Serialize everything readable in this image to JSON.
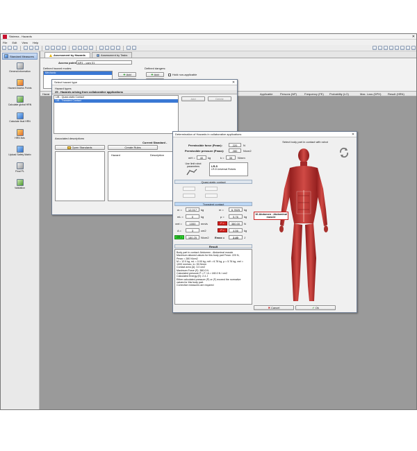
{
  "app": {
    "title": "Sistema - Hazards",
    "menu": [
      "File",
      "Edit",
      "View",
      "Help"
    ]
  },
  "sidebar": {
    "header": "Standard Measures",
    "items": [
      {
        "label": "General information",
        "icon": "info-document-icon"
      },
      {
        "label": "Hazard Assess Points",
        "icon": "hazard-points-icon"
      },
      {
        "label": "Calculate global HRN",
        "icon": "calculator-icon"
      },
      {
        "label": "Calculate final HRN",
        "icon": "calculator-final-icon"
      },
      {
        "label": "HRN lists",
        "icon": "list-icon"
      },
      {
        "label": "Upload Safety Matrix",
        "icon": "upload-matrix-icon"
      },
      {
        "label": "Final PL",
        "icon": "final-pl-icon"
      },
      {
        "label": "Validation",
        "icon": "validation-icon"
      }
    ]
  },
  "tabs": [
    {
      "label": "Assessment by Hazards",
      "active": true
    },
    {
      "label": "Assessment by Tasks",
      "active": false
    }
  ],
  "panel": {
    "access_point_label": "Access point:",
    "access_point_value": "AR1 - cam 01",
    "defined_hazards_label": "Defined hazard modes:",
    "defined_dangers_label": "Defined dangers:",
    "hazard_row": "Mechanic",
    "add_label": "Add",
    "delete_label": "Delete",
    "not_applicable_label": "Hold non-applicable"
  },
  "grid_header": {
    "hazard": "Hazar",
    "applicable": "Applicable",
    "persons": "Persons (NP)",
    "frequency": "Frequency (FE)",
    "probability": "Probability (LO)",
    "max_loss": "Max. Loss (DPH)",
    "result": "Result (HRN)"
  },
  "hazard_dialog": {
    "title": "Select hazard type",
    "hazard_types_label": "Hazard types",
    "group": "25 - Hazards arising from collaborative applications",
    "items": [
      "LIB - Quasi-static Contact",
      "LIB - Transient Contact"
    ],
    "selected_index": 1,
    "add_label": "Add",
    "delete_label": "Delete",
    "associated_label": "Associated descriptions",
    "current_standard_label": "Current Standard -",
    "open_standards": "Open Standards",
    "create_rules": "Create Rules",
    "col_hazard": "Hazard",
    "col_description": "Description"
  },
  "determination": {
    "title": "Determination of Hazards in collaborative applications",
    "perm_force_label": "Permissible force (Fmax):",
    "perm_force_value": "220",
    "perm_force_unit": "N",
    "perm_pressure_label": "Permissible pressure (Pmax):",
    "perm_pressure_value": "280",
    "perm_pressure_unit": "N/cm2",
    "mh_label": "mH =",
    "mh_value": "40",
    "mh_unit": "kg",
    "k_label": "k =",
    "k_value": "35",
    "k_unit": "N/mm",
    "limit_params_label": "Use limit robot parameters",
    "lr_code": "LR-5",
    "lr_desc": "LR-5 Universal Robots",
    "quasi_static_label": "Quasi-static contact",
    "transient_label": "Transient contact",
    "rows": [
      {
        "l1": "m =",
        "v1": "12.017",
        "u1": "kg",
        "l2": "m =",
        "v2": "6.7825",
        "u2": "kg"
      },
      {
        "l1": "mL =",
        "v1": "0",
        "u1": "kg",
        "l2": "μ =",
        "v2": "5.76",
        "u2": "kg"
      },
      {
        "l1": "vrel =",
        "v1": "1000",
        "u1": "mm/s",
        "l2": "F =",
        "v2": "380.00",
        "u2": "N"
      },
      {
        "l1": "A =",
        "v1": "3",
        "u1": "cm2",
        "l2": "P =",
        "v2": "4.56",
        "u2": "kg"
      },
      {
        "l1": "CR =",
        "v1": "180.25",
        "u1": "N/cm2",
        "l2": "Emax =",
        "v2": "2.40",
        "u2": "J"
      }
    ],
    "select_body_label": "Select body part in contact with robot",
    "body_part_label": "10-Abdomen - Abdominal muscle",
    "result_title": "Result",
    "result_lines": [
      "Body part in contact: Abdomen - Abdominal muscle",
      "Maximum allowed values for this body part Fmax: 220 N,",
      "Pmax = 280 N/cm2",
      "M = 12.0 kg, mL = 0.00 kg, mH = 6.78 kg, μ = 5.76 kg, vrel =",
      "1000 mm/sec, k= 35 N/mm",
      "Contact area (A): 3.0 cm2",
      "Maximum Force (F): 380.0 N",
      "Calculated pressure P = F / A = 180.0 N / cm2",
      "Calculated Energy (E): 2.4 J",
      "Either calculated pressure (P) or (F) exceed the normative",
      "values for this body part.",
      "Corrective measures are required"
    ],
    "cancel_label": "Cancel",
    "ok_label": "Ok"
  },
  "colors": {
    "workspace": "#9a9a9a",
    "selection": "#3a78d4",
    "alert_red": "#d3221e",
    "ok_green": "#2ed12e"
  }
}
